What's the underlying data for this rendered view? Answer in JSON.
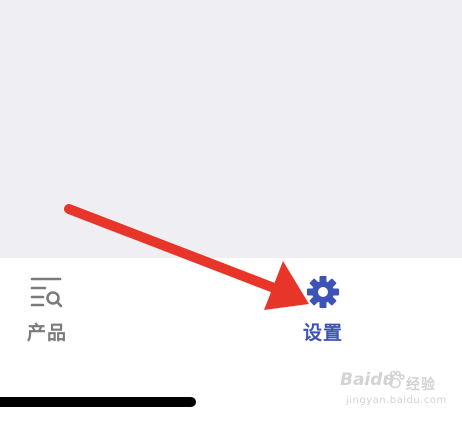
{
  "tab_bar": {
    "items": [
      {
        "label": "产品",
        "icon": "product-search-list-icon",
        "active": false
      },
      {
        "label": "设置",
        "icon": "gear-icon",
        "active": true
      }
    ]
  },
  "colors": {
    "content_background": "#efeef3",
    "tab_bar_background": "#ffffff",
    "inactive_tab": "#7b7b7b",
    "active_tab": "#3d54b6",
    "annotation_arrow": "#e8352a"
  },
  "watermark": {
    "logo_text": "Baidu",
    "logo_suffix": "经验",
    "url": "jingyan.baidu.com"
  }
}
